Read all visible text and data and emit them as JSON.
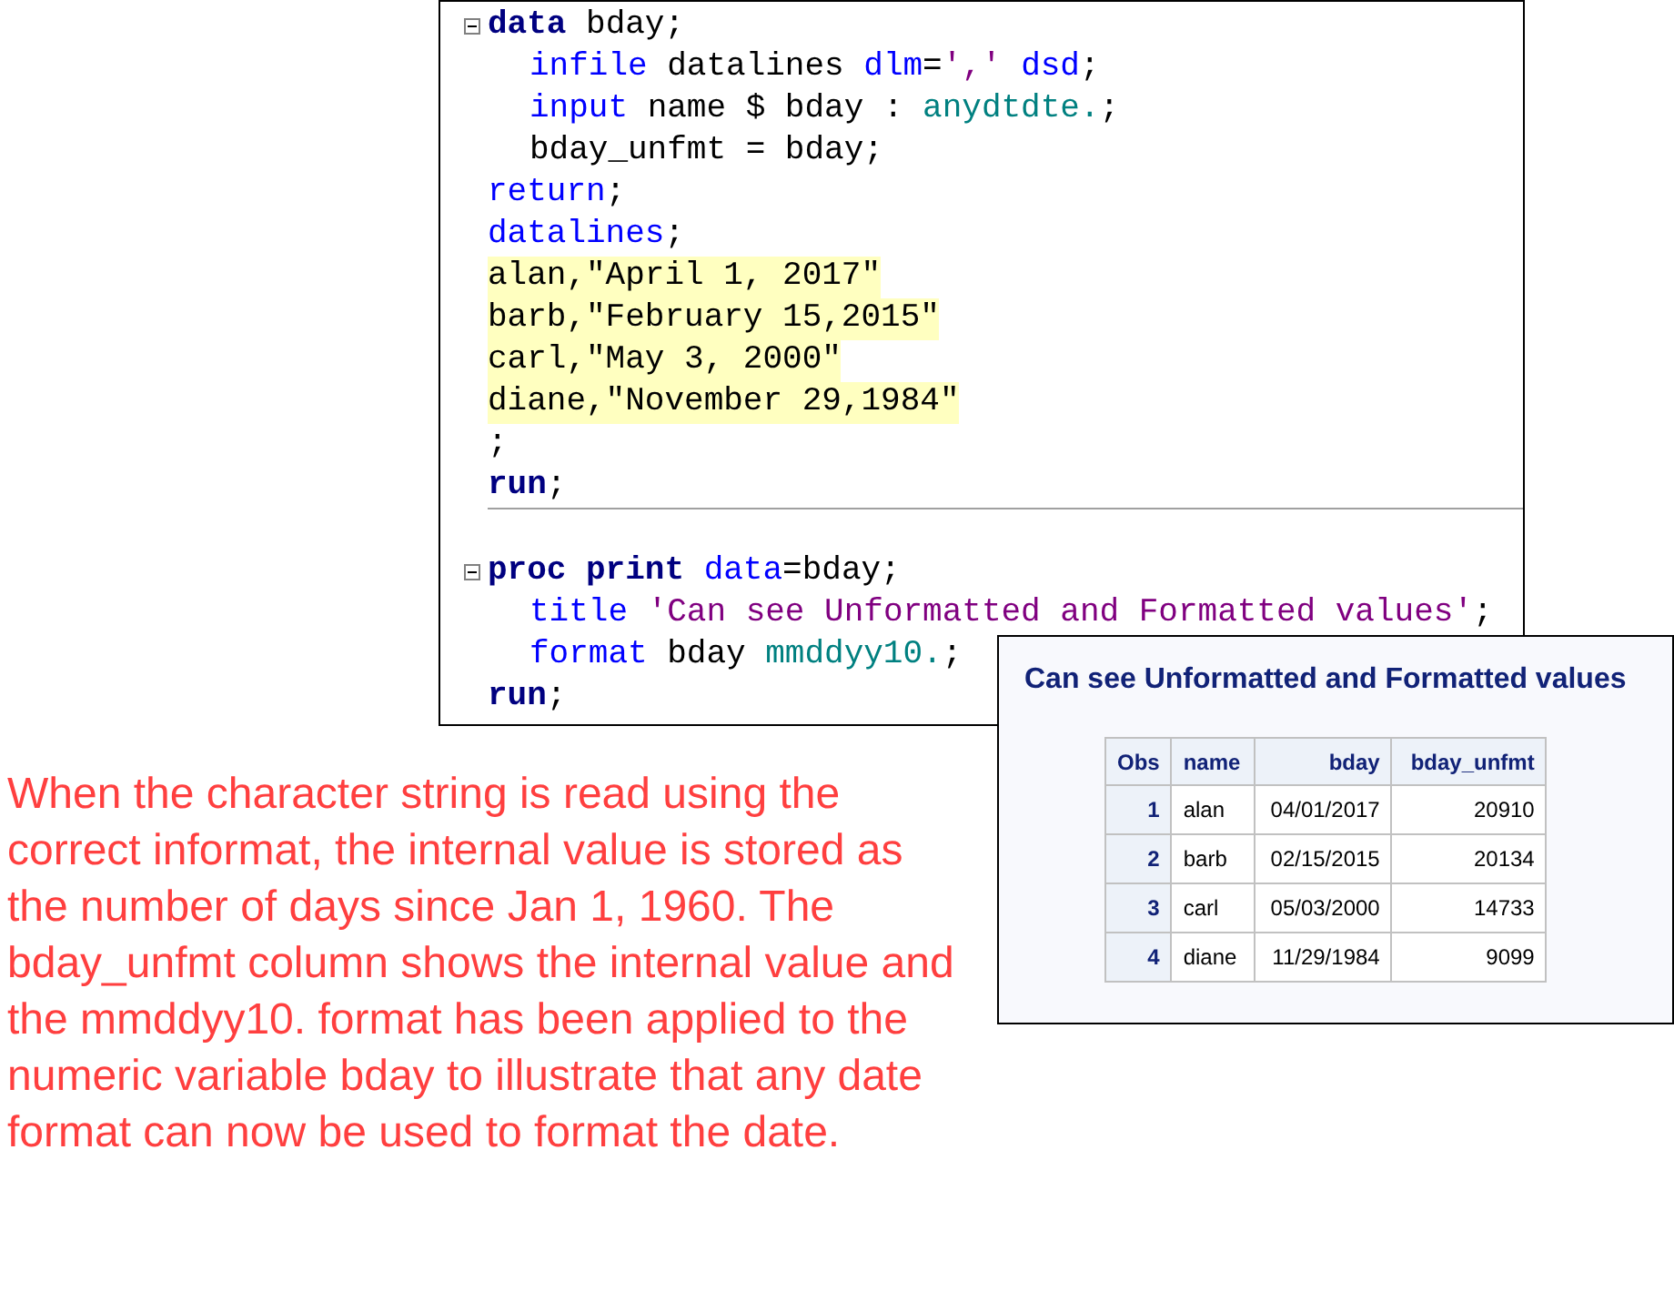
{
  "code_editor": {
    "blocks": [
      {
        "lines": [
          {
            "fold": true,
            "highlighted": false,
            "tokens": [
              {
                "kind": "step",
                "text": "data"
              },
              {
                "kind": "text",
                "text": " bday;"
              }
            ],
            "children": [
              {
                "fold": false,
                "highlighted": false,
                "tokens": [
                  {
                    "kind": "keyword",
                    "text": "infile"
                  },
                  {
                    "kind": "text",
                    "text": " datalines "
                  },
                  {
                    "kind": "keyword",
                    "text": "dlm"
                  },
                  {
                    "kind": "text",
                    "text": "="
                  },
                  {
                    "kind": "string",
                    "text": "','"
                  },
                  {
                    "kind": "keyword",
                    "text": " dsd"
                  },
                  {
                    "kind": "text",
                    "text": ";"
                  }
                ]
              },
              {
                "fold": false,
                "highlighted": false,
                "tokens": [
                  {
                    "kind": "keyword",
                    "text": "input"
                  },
                  {
                    "kind": "text",
                    "text": " name $ bday : "
                  },
                  {
                    "kind": "format",
                    "text": "anydtdte."
                  },
                  {
                    "kind": "text",
                    "text": ";"
                  }
                ]
              },
              {
                "fold": false,
                "highlighted": false,
                "tokens": [
                  {
                    "kind": "text",
                    "text": "bday_unfmt = bday;"
                  }
                ]
              }
            ]
          },
          {
            "fold": false,
            "highlighted": false,
            "tokens": [
              {
                "kind": "keyword",
                "text": "return"
              },
              {
                "kind": "text",
                "text": ";"
              }
            ]
          },
          {
            "fold": false,
            "highlighted": false,
            "tokens": [
              {
                "kind": "keyword",
                "text": "datalines"
              },
              {
                "kind": "text",
                "text": ";"
              }
            ]
          },
          {
            "fold": false,
            "highlighted": true,
            "tokens": [
              {
                "kind": "text",
                "text": "alan,\"April 1, 2017\""
              }
            ]
          },
          {
            "fold": false,
            "highlighted": true,
            "tokens": [
              {
                "kind": "text",
                "text": "barb,\"February 15,2015\""
              }
            ]
          },
          {
            "fold": false,
            "highlighted": true,
            "tokens": [
              {
                "kind": "text",
                "text": "carl,\"May 3, 2000\""
              }
            ]
          },
          {
            "fold": false,
            "highlighted": true,
            "tokens": [
              {
                "kind": "text",
                "text": "diane,\"November 29,1984\""
              }
            ]
          },
          {
            "fold": false,
            "highlighted": false,
            "tokens": [
              {
                "kind": "text",
                "text": ";"
              }
            ]
          },
          {
            "fold": false,
            "highlighted": false,
            "tokens": [
              {
                "kind": "step",
                "text": "run"
              },
              {
                "kind": "text",
                "text": ";"
              }
            ]
          }
        ]
      },
      {
        "lines": [
          {
            "fold": true,
            "highlighted": false,
            "tokens": [
              {
                "kind": "step",
                "text": "proc print"
              },
              {
                "kind": "keyword",
                "text": " data"
              },
              {
                "kind": "text",
                "text": "=bday;"
              }
            ],
            "children": [
              {
                "fold": false,
                "highlighted": false,
                "tokens": [
                  {
                    "kind": "keyword",
                    "text": "title"
                  },
                  {
                    "kind": "string",
                    "text": " 'Can see Unformatted and Formatted values'"
                  },
                  {
                    "kind": "text",
                    "text": ";"
                  }
                ]
              },
              {
                "fold": false,
                "highlighted": false,
                "tokens": [
                  {
                    "kind": "keyword",
                    "text": "format"
                  },
                  {
                    "kind": "text",
                    "text": " bday "
                  },
                  {
                    "kind": "format",
                    "text": "mmddyy10."
                  },
                  {
                    "kind": "text",
                    "text": ";"
                  }
                ]
              }
            ]
          },
          {
            "fold": false,
            "highlighted": false,
            "tokens": [
              {
                "kind": "step",
                "text": "run"
              },
              {
                "kind": "text",
                "text": ";"
              }
            ]
          }
        ]
      }
    ]
  },
  "output": {
    "title": "Can see Unformatted and Formatted values",
    "table": {
      "columns": [
        "Obs",
        "name",
        "bday",
        "bday_unfmt"
      ],
      "rows": [
        [
          "1",
          "alan",
          "04/01/2017",
          "20910"
        ],
        [
          "2",
          "barb",
          "02/15/2015",
          "20134"
        ],
        [
          "3",
          "carl",
          "05/03/2000",
          "14733"
        ],
        [
          "4",
          "diane",
          "11/29/1984",
          "9099"
        ]
      ]
    }
  },
  "note": "When the character string is read using the correct informat, the internal value is stored as the number of days since Jan 1, 1960. The bday_unfmt column shows the internal value and the mmddyy10. format has been applied to the numeric variable bday to illustrate that any date format can now be used to format the date."
}
